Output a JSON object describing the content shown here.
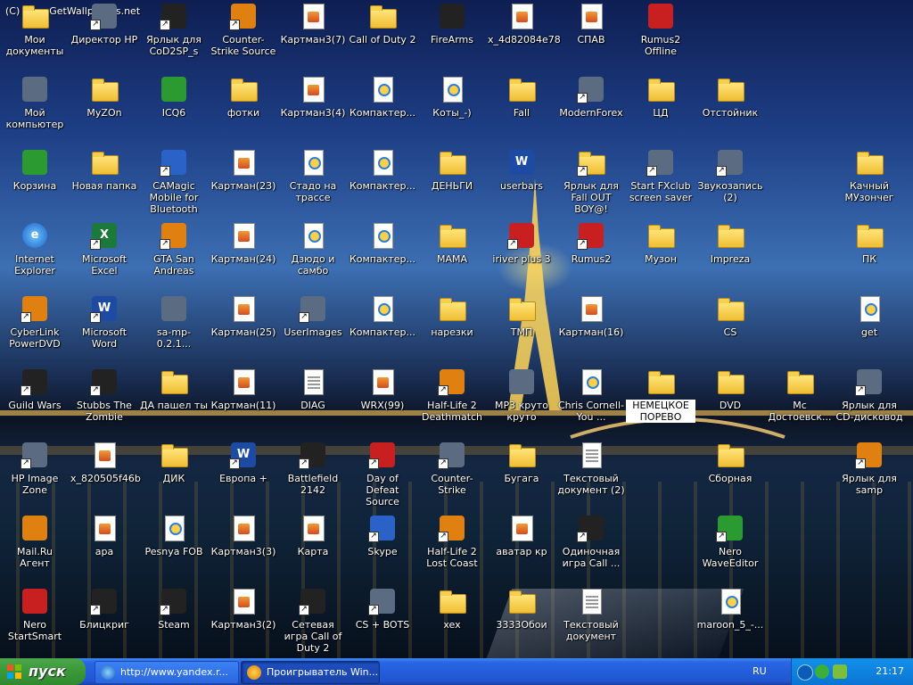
{
  "desktop": {
    "watermark": "(C) www.GetWallpapers.net",
    "icons": [
      {
        "label": "Мои документы",
        "type": "folder-doc",
        "col": 0,
        "row": 0
      },
      {
        "label": "Директор HP",
        "type": "generic",
        "col": 1,
        "row": 0,
        "shortcut": true
      },
      {
        "label": "Ярлык для CoD2SP_s",
        "type": "black",
        "col": 2,
        "row": 0,
        "shortcut": true
      },
      {
        "label": "Counter-Strike Source",
        "type": "orange",
        "col": 3,
        "row": 0,
        "shortcut": true
      },
      {
        "label": "Картман3(7)",
        "type": "img",
        "col": 4,
        "row": 0
      },
      {
        "label": "Call of Duty 2",
        "type": "folder",
        "col": 5,
        "row": 0
      },
      {
        "label": "FireArms",
        "type": "black",
        "col": 6,
        "row": 0
      },
      {
        "label": "x_4d82084e78",
        "type": "img",
        "col": 7,
        "row": 0
      },
      {
        "label": "СПАВ",
        "type": "img",
        "col": 8,
        "row": 0
      },
      {
        "label": "Rumus2 Offline",
        "type": "red",
        "col": 9,
        "row": 0
      },
      {
        "label": "Мой компьютер",
        "type": "generic",
        "col": 0,
        "row": 1
      },
      {
        "label": "MyZOn",
        "type": "folder",
        "col": 1,
        "row": 1
      },
      {
        "label": "ICQ6",
        "type": "green",
        "col": 2,
        "row": 1
      },
      {
        "label": "фотки",
        "type": "folder",
        "col": 3,
        "row": 1
      },
      {
        "label": "Картман3(4)",
        "type": "img",
        "col": 4,
        "row": 1
      },
      {
        "label": "Компактер...",
        "type": "media",
        "col": 5,
        "row": 1
      },
      {
        "label": "Коты_-)",
        "type": "media",
        "col": 6,
        "row": 1
      },
      {
        "label": "Fall",
        "type": "folder",
        "col": 7,
        "row": 1
      },
      {
        "label": "ModernForex",
        "type": "generic",
        "col": 8,
        "row": 1,
        "shortcut": true
      },
      {
        "label": "ЦД",
        "type": "folder",
        "col": 9,
        "row": 1
      },
      {
        "label": "Отстойник",
        "type": "folder",
        "col": 10,
        "row": 1
      },
      {
        "label": "Корзина",
        "type": "green",
        "col": 0,
        "row": 2
      },
      {
        "label": "Новая папка",
        "type": "folder",
        "col": 1,
        "row": 2
      },
      {
        "label": "CAMagic Mobile for Bluetooth",
        "type": "blue",
        "col": 2,
        "row": 2,
        "shortcut": true
      },
      {
        "label": "Картман(23)",
        "type": "img",
        "col": 3,
        "row": 2
      },
      {
        "label": "Стадо на трассе",
        "type": "media",
        "col": 4,
        "row": 2
      },
      {
        "label": "Компактер...",
        "type": "media",
        "col": 5,
        "row": 2
      },
      {
        "label": "ДЕНЬГИ",
        "type": "folder",
        "col": 6,
        "row": 2
      },
      {
        "label": "userbars",
        "type": "word",
        "col": 7,
        "row": 2
      },
      {
        "label": "Ярлык для Fall OUT BOY@!",
        "type": "folder",
        "col": 8,
        "row": 2,
        "shortcut": true
      },
      {
        "label": "Start FXclub screen saver",
        "type": "generic",
        "col": 9,
        "row": 2,
        "shortcut": true
      },
      {
        "label": "Звукозапись (2)",
        "type": "generic",
        "col": 10,
        "row": 2,
        "shortcut": true
      },
      {
        "label": "Качный МУзончег",
        "type": "folder",
        "col": 12,
        "row": 2
      },
      {
        "label": "Internet Explorer",
        "type": "ie",
        "col": 0,
        "row": 3
      },
      {
        "label": "Microsoft Excel",
        "type": "excel",
        "col": 1,
        "row": 3,
        "shortcut": true
      },
      {
        "label": "GTA San Andreas",
        "type": "orange",
        "col": 2,
        "row": 3,
        "shortcut": true
      },
      {
        "label": "Картман(24)",
        "type": "img",
        "col": 3,
        "row": 3
      },
      {
        "label": "Дзюдо и самбо",
        "type": "media",
        "col": 4,
        "row": 3
      },
      {
        "label": "Компактер...",
        "type": "media",
        "col": 5,
        "row": 3
      },
      {
        "label": "MAMA",
        "type": "folder",
        "col": 6,
        "row": 3
      },
      {
        "label": "iriver plus 3",
        "type": "red",
        "col": 7,
        "row": 3,
        "shortcut": true
      },
      {
        "label": "Rumus2",
        "type": "red",
        "col": 8,
        "row": 3,
        "shortcut": true
      },
      {
        "label": "Музон",
        "type": "folder",
        "col": 9,
        "row": 3
      },
      {
        "label": "Impreza",
        "type": "folder",
        "col": 10,
        "row": 3
      },
      {
        "label": "ПК",
        "type": "folder",
        "col": 12,
        "row": 3
      },
      {
        "label": "CyberLink PowerDVD",
        "type": "orange",
        "col": 0,
        "row": 4,
        "shortcut": true
      },
      {
        "label": "Microsoft Word",
        "type": "word",
        "col": 1,
        "row": 4,
        "shortcut": true
      },
      {
        "label": "sa-mp-0.2.1...",
        "type": "generic",
        "col": 2,
        "row": 4
      },
      {
        "label": "Картман(25)",
        "type": "img",
        "col": 3,
        "row": 4
      },
      {
        "label": "UserImages",
        "type": "generic",
        "col": 4,
        "row": 4,
        "shortcut": true
      },
      {
        "label": "Компактер...",
        "type": "media",
        "col": 5,
        "row": 4
      },
      {
        "label": "нарезки",
        "type": "folder",
        "col": 6,
        "row": 4
      },
      {
        "label": "ТМП",
        "type": "folder",
        "col": 7,
        "row": 4
      },
      {
        "label": "Картман(16)",
        "type": "img",
        "col": 8,
        "row": 4
      },
      {
        "label": "CS",
        "type": "folder",
        "col": 10,
        "row": 4
      },
      {
        "label": "get",
        "type": "media",
        "col": 12,
        "row": 4
      },
      {
        "label": "Guild Wars",
        "type": "black",
        "col": 0,
        "row": 5,
        "shortcut": true
      },
      {
        "label": "Stubbs The Zombie",
        "type": "black",
        "col": 1,
        "row": 5,
        "shortcut": true
      },
      {
        "label": "ДА пашел ты",
        "type": "folder",
        "col": 2,
        "row": 5
      },
      {
        "label": "Картман(11)",
        "type": "img",
        "col": 3,
        "row": 5
      },
      {
        "label": "DIAG",
        "type": "doc",
        "col": 4,
        "row": 5
      },
      {
        "label": "WRX(99)",
        "type": "img",
        "col": 5,
        "row": 5
      },
      {
        "label": "Half-Life 2 Deathmatch",
        "type": "orange",
        "col": 6,
        "row": 5,
        "shortcut": true
      },
      {
        "label": "MP3 круто круто",
        "type": "generic",
        "col": 7,
        "row": 5
      },
      {
        "label": "Chris Cornell-You ...",
        "type": "media",
        "col": 8,
        "row": 5
      },
      {
        "label": "НЕМЕЦКОЕ ПОРЕВО",
        "type": "folder",
        "col": 9,
        "row": 5,
        "selected": true
      },
      {
        "label": "DVD",
        "type": "folder",
        "col": 10,
        "row": 5
      },
      {
        "label": "Мс Достоевск...",
        "type": "folder",
        "col": 11,
        "row": 5
      },
      {
        "label": "Ярлык для CD-дисковод",
        "type": "generic",
        "col": 12,
        "row": 5,
        "shortcut": true
      },
      {
        "label": "HP Image Zone",
        "type": "generic",
        "col": 0,
        "row": 6,
        "shortcut": true
      },
      {
        "label": "x_820505f46b",
        "type": "img",
        "col": 1,
        "row": 6
      },
      {
        "label": "ДИК",
        "type": "folder",
        "col": 2,
        "row": 6
      },
      {
        "label": "Европа +",
        "type": "word",
        "col": 3,
        "row": 6,
        "shortcut": true
      },
      {
        "label": "Battlefield 2142",
        "type": "black",
        "col": 4,
        "row": 6,
        "shortcut": true
      },
      {
        "label": "Day of Defeat Source",
        "type": "red",
        "col": 5,
        "row": 6,
        "shortcut": true
      },
      {
        "label": "Counter-Strike",
        "type": "generic",
        "col": 6,
        "row": 6,
        "shortcut": true
      },
      {
        "label": "Бугага",
        "type": "folder",
        "col": 7,
        "row": 6
      },
      {
        "label": "Текстовый документ (2)",
        "type": "doc",
        "col": 8,
        "row": 6
      },
      {
        "label": "Сборная",
        "type": "folder",
        "col": 10,
        "row": 6
      },
      {
        "label": "Ярлык для samp",
        "type": "orange",
        "col": 12,
        "row": 6,
        "shortcut": true
      },
      {
        "label": "Mail.Ru Агент",
        "type": "orange",
        "col": 0,
        "row": 7
      },
      {
        "label": "apa",
        "type": "img",
        "col": 1,
        "row": 7
      },
      {
        "label": "Pesnya FOB",
        "type": "media",
        "col": 2,
        "row": 7
      },
      {
        "label": "Картман3(3)",
        "type": "img",
        "col": 3,
        "row": 7
      },
      {
        "label": "Карта",
        "type": "img",
        "col": 4,
        "row": 7
      },
      {
        "label": "Skype",
        "type": "blue",
        "col": 5,
        "row": 7,
        "shortcut": true
      },
      {
        "label": "Half-Life 2 Lost Coast",
        "type": "orange",
        "col": 6,
        "row": 7,
        "shortcut": true
      },
      {
        "label": "аватар кр",
        "type": "img",
        "col": 7,
        "row": 7
      },
      {
        "label": "Одиночная игра Call ...",
        "type": "black",
        "col": 8,
        "row": 7,
        "shortcut": true
      },
      {
        "label": "Nero WaveEditor",
        "type": "green",
        "col": 10,
        "row": 7,
        "shortcut": true
      },
      {
        "label": "Nero StartSmart",
        "type": "red",
        "col": 0,
        "row": 8
      },
      {
        "label": "Блицкриг",
        "type": "black",
        "col": 1,
        "row": 8,
        "shortcut": true
      },
      {
        "label": "Steam",
        "type": "black",
        "col": 2,
        "row": 8,
        "shortcut": true
      },
      {
        "label": "Картман3(2)",
        "type": "img",
        "col": 3,
        "row": 8
      },
      {
        "label": "Сетевая игра Call of Duty 2",
        "type": "black",
        "col": 4,
        "row": 8,
        "shortcut": true
      },
      {
        "label": "CS + BOTS",
        "type": "generic",
        "col": 5,
        "row": 8,
        "shortcut": true
      },
      {
        "label": "xex",
        "type": "folder",
        "col": 6,
        "row": 8
      },
      {
        "label": "3333Обои",
        "type": "folder",
        "col": 7,
        "row": 8
      },
      {
        "label": "Текстовый документ",
        "type": "doc",
        "col": 8,
        "row": 8
      },
      {
        "label": "maroon_5_-...",
        "type": "media",
        "col": 10,
        "row": 8
      }
    ]
  },
  "taskbar": {
    "start_label": "пуск",
    "tasks": [
      {
        "label": "http://www.yandex.r...",
        "icon": "ie-icon",
        "active": false
      },
      {
        "label": "Проигрыватель Win...",
        "icon": "media-player-icon",
        "active": true
      }
    ],
    "language": "RU",
    "clock": "21:17"
  }
}
